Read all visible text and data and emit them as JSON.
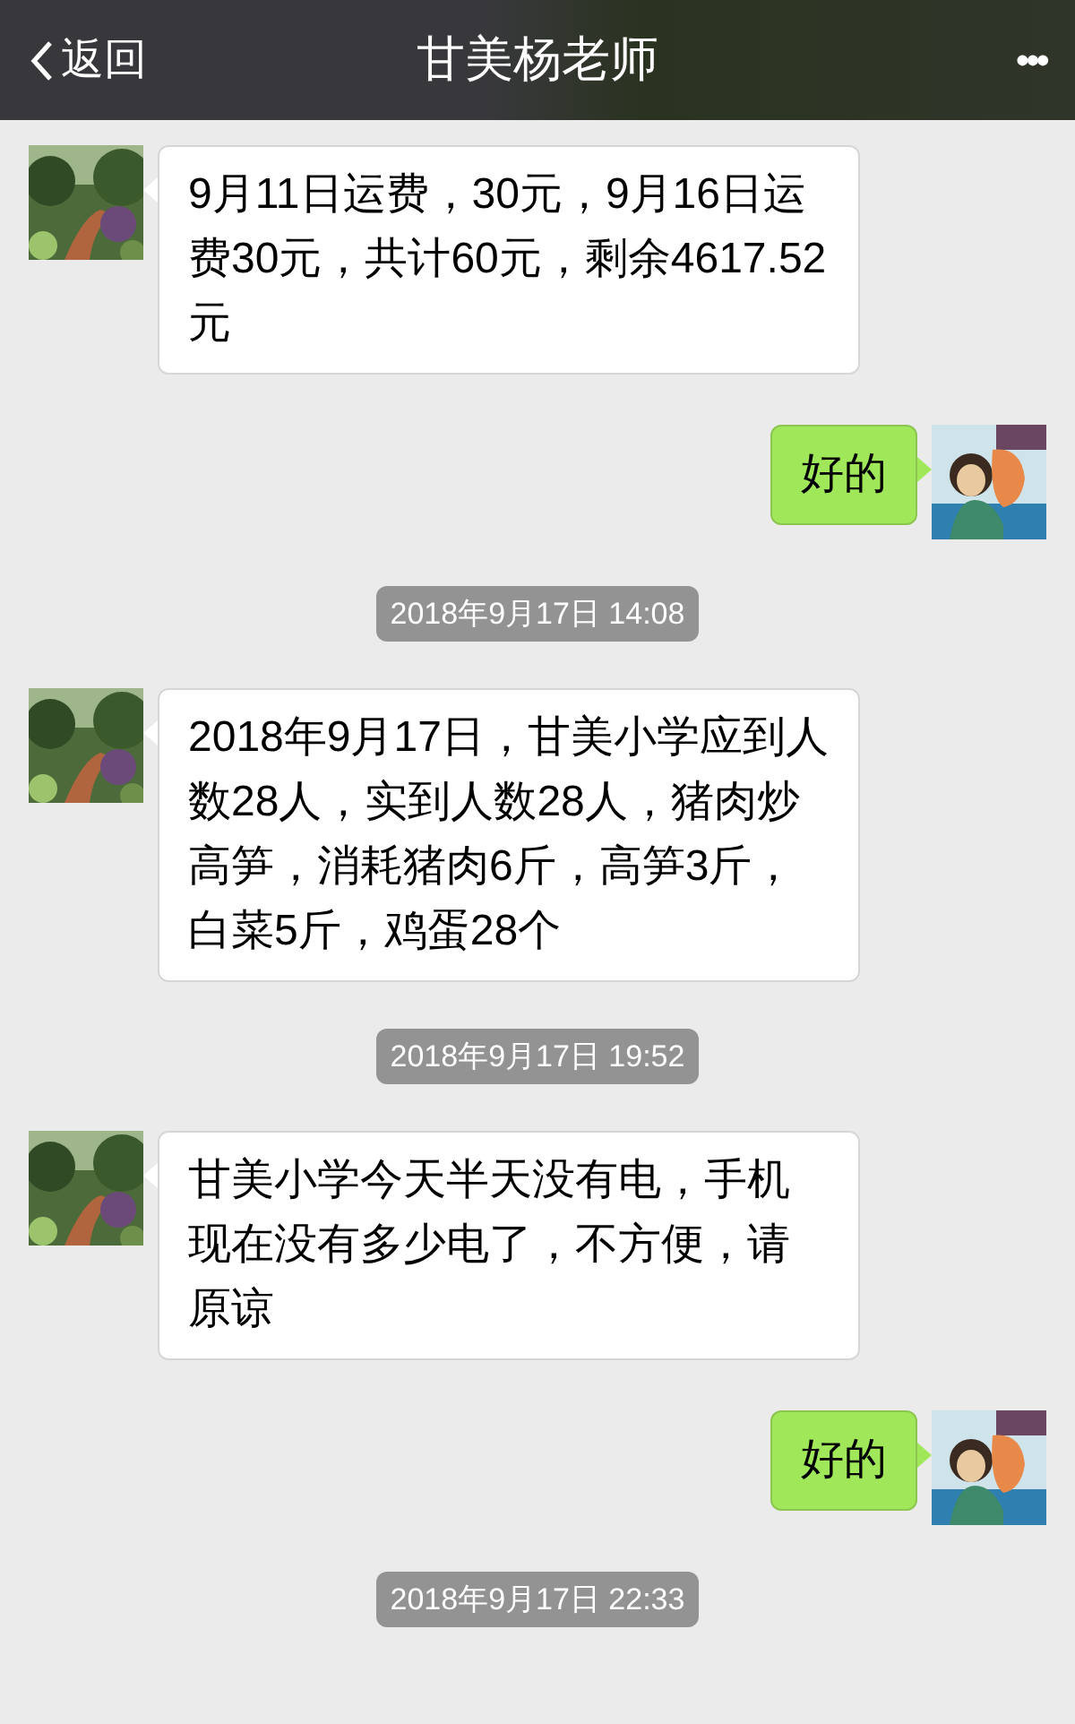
{
  "header": {
    "back": "返回",
    "title": "甘美杨老师",
    "more": "•••"
  },
  "messages": [
    {
      "kind": "message",
      "outgoing": false,
      "text": "9月11日运费，30元，9月16日运费30元，共计60元，剩余4617.52元"
    },
    {
      "kind": "message",
      "outgoing": true,
      "text": "好的"
    },
    {
      "kind": "time",
      "text": "2018年9月17日 14:08"
    },
    {
      "kind": "message",
      "outgoing": false,
      "text": "2018年9月17日，甘美小学应到人数28人，实到人数28人，猪肉炒高笋，消耗猪肉6斤，高笋3斤，白菜5斤，鸡蛋28个"
    },
    {
      "kind": "time",
      "text": "2018年9月17日 19:52"
    },
    {
      "kind": "message",
      "outgoing": false,
      "text": "甘美小学今天半天没有电，手机现在没有多少电了，不方便，请原谅"
    },
    {
      "kind": "message",
      "outgoing": true,
      "text": "好的"
    },
    {
      "kind": "time",
      "text": "2018年9月17日 22:33"
    }
  ]
}
